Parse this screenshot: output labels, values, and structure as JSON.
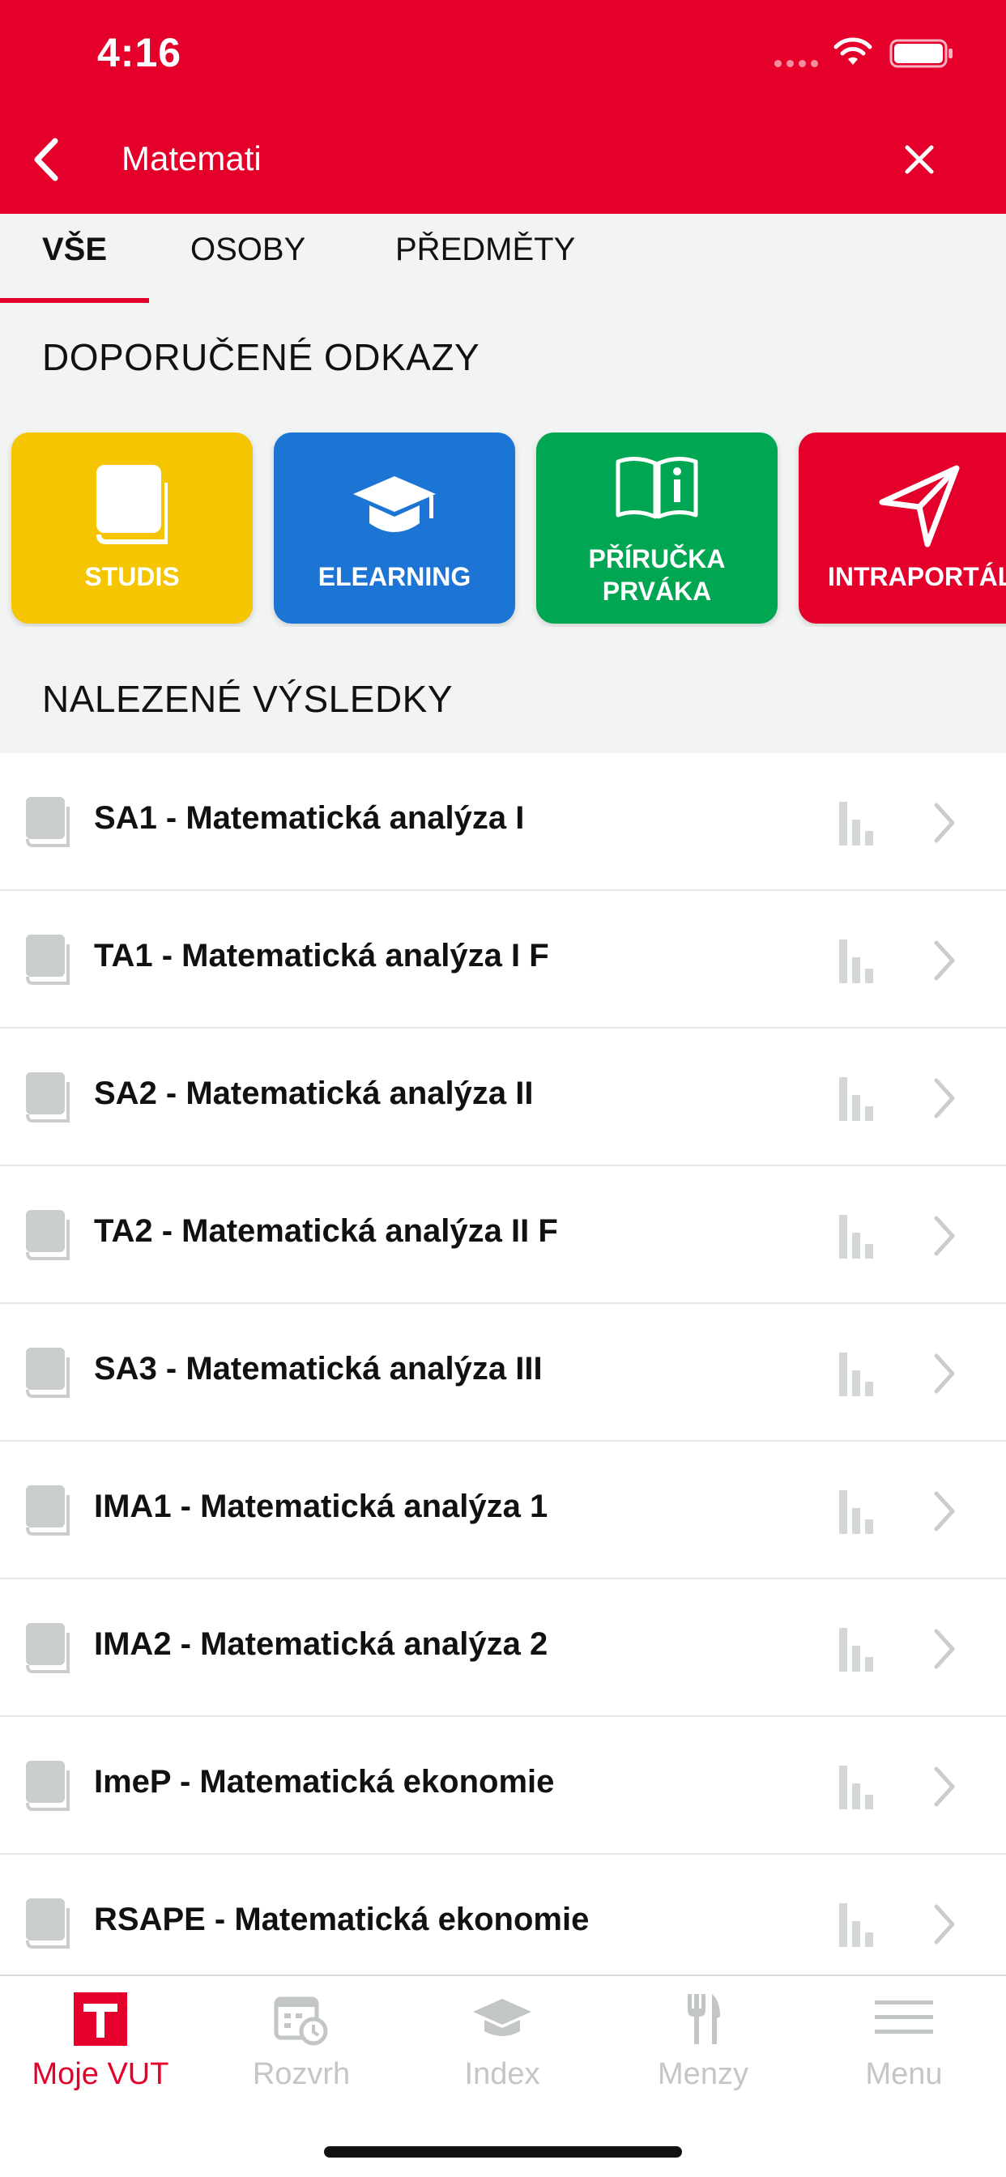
{
  "status": {
    "time": "4:16"
  },
  "search": {
    "query": "Matemati"
  },
  "tabs": [
    {
      "label": "VŠE",
      "active": true
    },
    {
      "label": "OSOBY",
      "active": false
    },
    {
      "label": "PŘEDMĚTY",
      "active": false
    }
  ],
  "sections": {
    "recommended": "DOPORUČENÉ ODKAZY",
    "results": "NALEZENÉ VÝSLEDKY"
  },
  "tiles": [
    {
      "label": "STUDIS",
      "icon": "book-icon",
      "color": "#f4c500"
    },
    {
      "label": "ELEARNING",
      "icon": "graduation-cap-icon",
      "color": "#1c74d4"
    },
    {
      "label": "PŘÍRUČKA\nPRVÁKA",
      "icon": "info-book-icon",
      "color": "#00a651"
    },
    {
      "label": "INTRAPORTÁL",
      "icon": "send-icon",
      "color": "#e4002b"
    }
  ],
  "results": [
    {
      "label": "SA1 - Matematická analýza I"
    },
    {
      "label": "TA1 - Matematická analýza I F"
    },
    {
      "label": "SA2 - Matematická analýza II"
    },
    {
      "label": "TA2 - Matematická analýza II F"
    },
    {
      "label": "SA3 - Matematická analýza III"
    },
    {
      "label": "IMA1 - Matematická analýza 1"
    },
    {
      "label": "IMA2 - Matematická analýza 2"
    },
    {
      "label": "ImeP - Matematická ekonomie"
    },
    {
      "label": "RSAPE - Matematická ekonomie"
    }
  ],
  "tabbar": [
    {
      "label": "Moje VUT",
      "icon": "vut-logo-icon",
      "active": true
    },
    {
      "label": "Rozvrh",
      "icon": "calendar-clock-icon",
      "active": false
    },
    {
      "label": "Index",
      "icon": "graduation-cap-icon",
      "active": false
    },
    {
      "label": "Menzy",
      "icon": "fork-knife-icon",
      "active": false
    },
    {
      "label": "Menu",
      "icon": "hamburger-menu-icon",
      "active": false
    }
  ],
  "colors": {
    "brand": "#e4002b",
    "inactive": "#c2c6c5",
    "background": "#f2f4f3"
  }
}
